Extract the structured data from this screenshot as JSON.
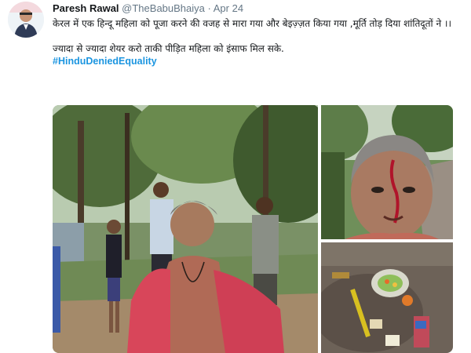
{
  "tweet": {
    "author_name": "Paresh Rawal",
    "handle": "@TheBabuBhaiya",
    "separator": "·",
    "date": "Apr 24",
    "text_line1": "केरल में एक हिन्दू महिला को पूजा करने की  वजह से मारा गया और बेइज़्ज़त किया  गया ,मूर्ति तोड़ दिया शांतिदूतों ने ।।",
    "text_line2": "ज्यादा से ज्यादा शेयर करो ताकी पीड़ित महिला को इंसाफ मिल सके.",
    "hashtag": "#HinduDeniedEquality"
  },
  "media": {
    "photo_count": 3,
    "photos": [
      {
        "name": "main-photo",
        "subject": "woman in pink sari with people behind on forest path"
      },
      {
        "name": "closeup-photo",
        "subject": "close-up of woman's bloodied face"
      },
      {
        "name": "shrine-photo",
        "subject": "broken idol and offerings on ground"
      }
    ]
  },
  "colors": {
    "name": "#14171a",
    "meta": "#657786",
    "link": "#1b95e0"
  }
}
